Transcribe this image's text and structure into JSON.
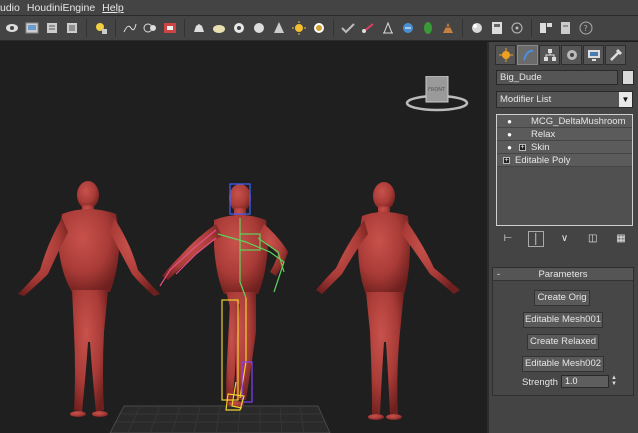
{
  "menubar": {
    "items": [
      "udio",
      "HoudiniEngine",
      "Help"
    ]
  },
  "toolbar": {
    "icons": [
      "select-icon",
      "viewport-icon",
      "layer-icon",
      "graph-icon",
      "render-setup-icon",
      "curve-icon",
      "schematic-icon",
      "material-icon",
      "teapot-icon",
      "sphere-icon",
      "torus-icon",
      "cone-icon",
      "light-icon",
      "target-icon",
      "particle-icon",
      "paint-icon",
      "bones-icon",
      "cloth-icon",
      "hair-icon",
      "tree-icon",
      "globe-icon",
      "panel-icon",
      "help-icon"
    ]
  },
  "cmdpanel": {
    "object_name": "Big_Dude",
    "modifier_list": "Modifier List",
    "stack": [
      {
        "label": "MCG_DeltaMushroom",
        "bulb": true,
        "plus": false
      },
      {
        "label": "Relax",
        "bulb": true,
        "plus": false
      },
      {
        "label": "Skin",
        "bulb": true,
        "plus": true
      },
      {
        "label": "Editable Poly",
        "bulb": false,
        "plus": true
      }
    ],
    "params_title": "Parameters",
    "buttons": {
      "create_orig": "Create Orig",
      "editable_mesh001": "Editable Mesh001",
      "create_relaxed": "Create Relaxed",
      "editable_mesh002": "Editable Mesh002"
    },
    "strength_label": "Strength",
    "strength_value": "1.0"
  },
  "viewcube": {
    "face_label": "FRONT"
  },
  "colors": {
    "skin": "#b8413d",
    "skin_shadow": "#7a2522",
    "viewport_bg": "#1f1f1f",
    "bone_green": "#5fd35a",
    "bone_yellow": "#f0d030",
    "bone_pink": "#e0508a",
    "bone_blue": "#4060ff"
  }
}
